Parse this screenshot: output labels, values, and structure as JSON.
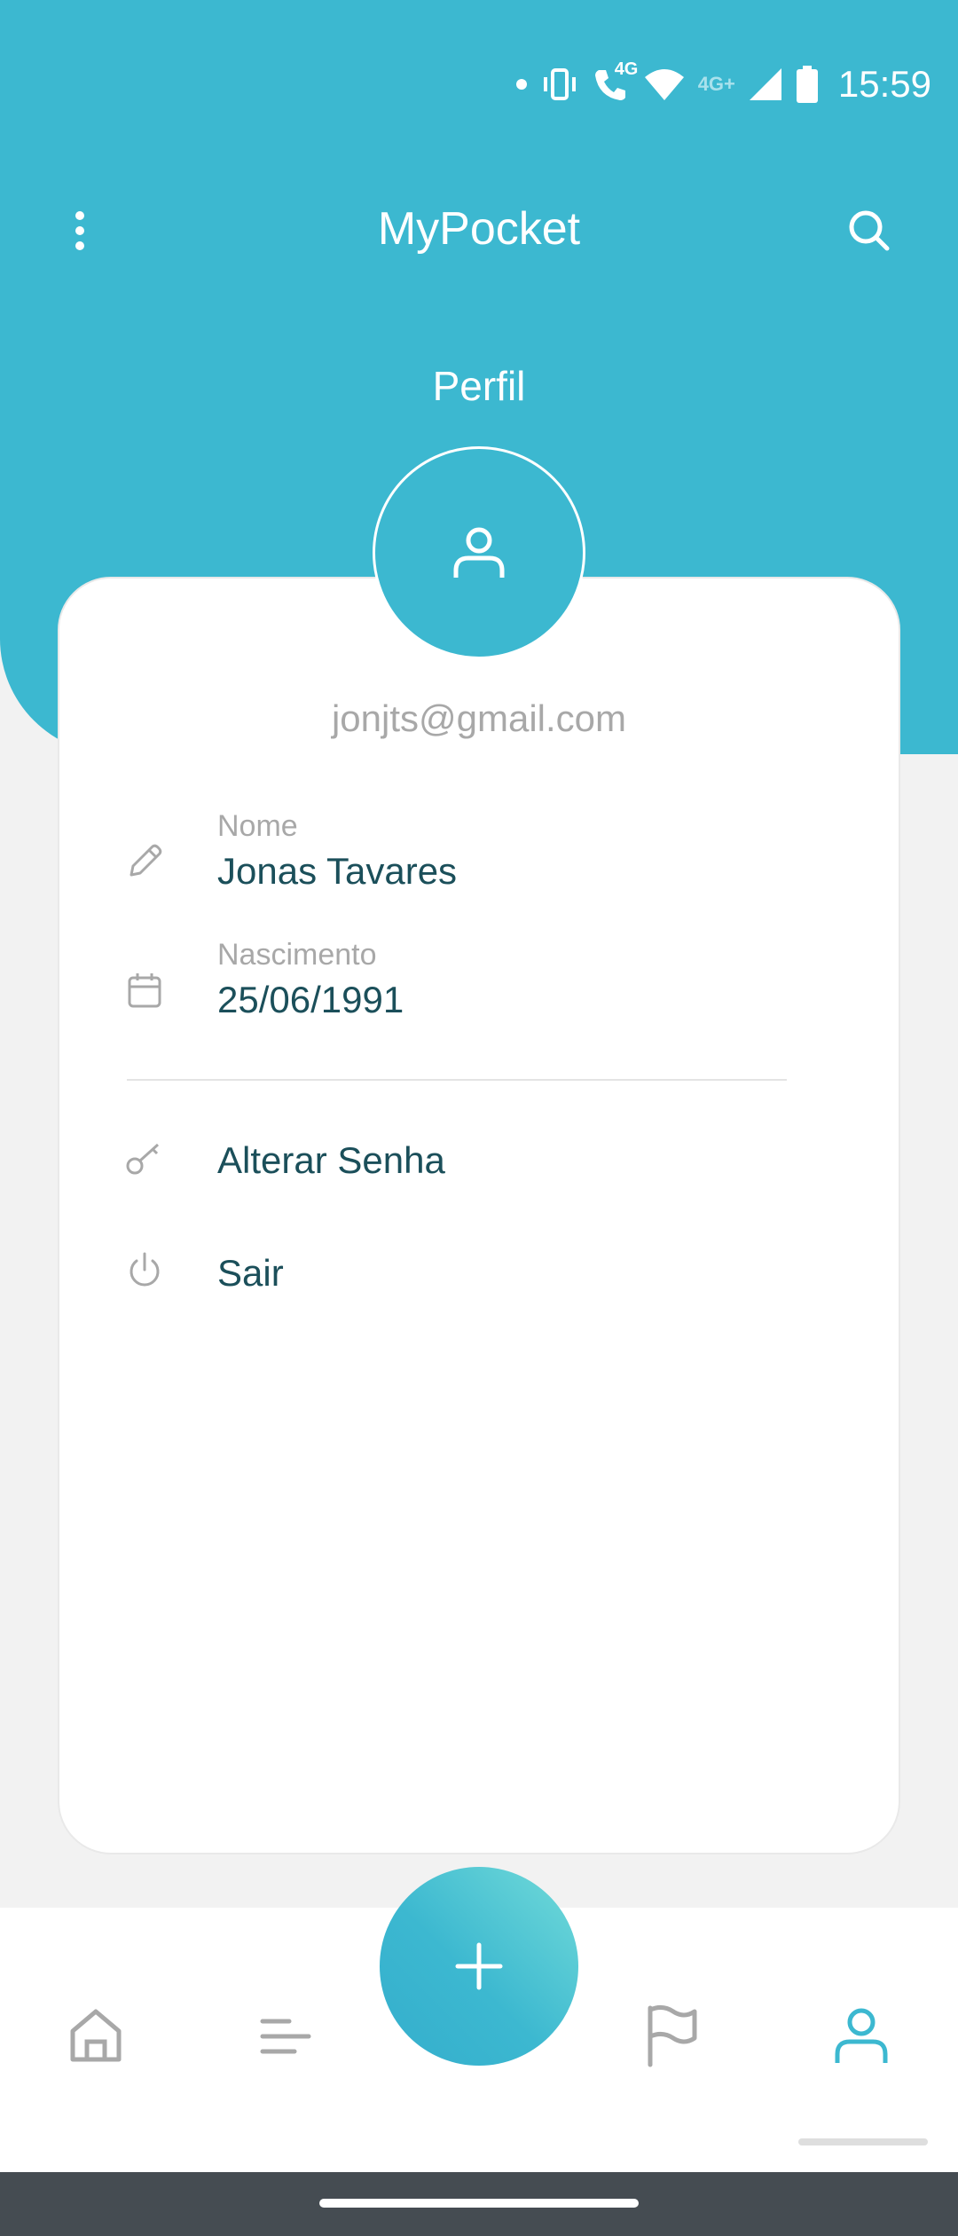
{
  "status_bar": {
    "time": "15:59",
    "network_label": "4G+",
    "call_label": "4G",
    "icons": [
      "notification-dot-icon",
      "vibrate-icon",
      "wifi-call-icon",
      "wifi-icon",
      "signal-icon",
      "battery-icon"
    ]
  },
  "app_bar": {
    "title": "MyPocket",
    "menu_icon": "more-vert-icon",
    "search_icon": "search-icon"
  },
  "profile": {
    "title": "Perfil",
    "avatar_icon": "person-icon",
    "email": "jonjts@gmail.com",
    "fields": [
      {
        "label": "Nome",
        "value": "Jonas Tavares",
        "icon": "pencil-icon"
      },
      {
        "label": "Nascimento",
        "value": "25/06/1991",
        "icon": "calendar-icon"
      }
    ],
    "actions": [
      {
        "label": "Alterar Senha",
        "icon": "key-icon"
      },
      {
        "label": "Sair",
        "icon": "power-icon"
      }
    ]
  },
  "bottom_nav": {
    "items": [
      "home-icon",
      "list-icon",
      "flag-icon",
      "profile-icon"
    ],
    "active": "profile-icon",
    "fab_icon": "plus-icon"
  },
  "colors": {
    "primary": "#3cb8d0",
    "text_dark": "#1b4f5a",
    "text_muted": "#a8a8a8",
    "background": "#f2f2f2"
  }
}
